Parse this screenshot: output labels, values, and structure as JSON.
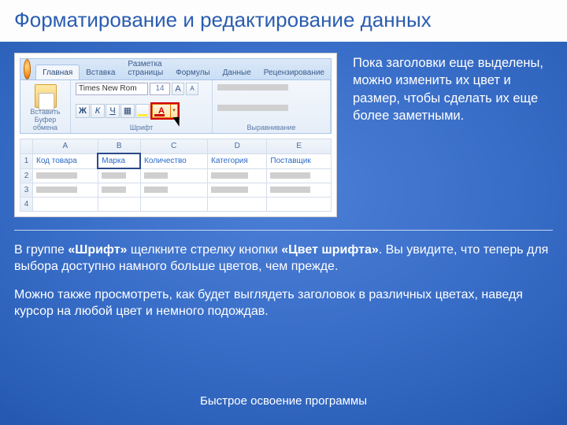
{
  "title": "Форматирование и редактирование данных",
  "aside": "Пока заголовки еще выделены, можно изменить их цвет и размер, чтобы сделать их еще более заметными.",
  "ribbon": {
    "tabs": [
      "Главная",
      "Вставка",
      "Разметка страницы",
      "Формулы",
      "Данные",
      "Рецензирование"
    ],
    "paste": "Вставить",
    "clipboard_label": "Буфер обмена",
    "font_name": "Times New Rom",
    "font_size": "14",
    "grow": "A",
    "shrink": "A",
    "bold": "Ж",
    "italic": "К",
    "underline": "Ч",
    "font_label": "Шрифт",
    "align_label": "Выравнивание"
  },
  "sheet": {
    "cols": [
      "A",
      "B",
      "C",
      "D",
      "E"
    ],
    "headers": [
      "Код товара",
      "Марка",
      "Количество",
      "Категория",
      "Поставщик"
    ]
  },
  "p1_a": "В группе ",
  "p1_b": "«Шрифт»",
  "p1_c": " щелкните стрелку кнопки ",
  "p1_d": "«Цвет шрифта»",
  "p1_e": ". Вы увидите, что теперь для выбора доступно намного больше цветов, чем прежде.",
  "p2": "Можно также просмотреть, как будет выглядеть заголовок в различных цветах, наведя курсор на любой цвет и немного подождав.",
  "footer": "Быстрое освоение программы"
}
